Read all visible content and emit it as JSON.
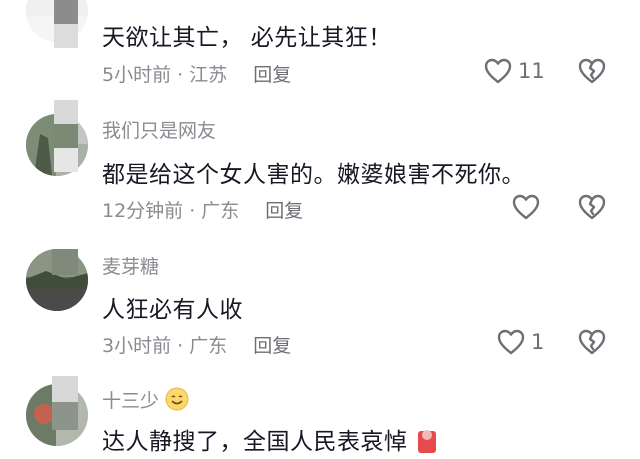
{
  "comments": [
    {
      "username": "",
      "text": "天欲让其亡， 必先让其狂！",
      "meta": "5小时前 · 江苏",
      "reply": "回复",
      "likes": "11",
      "icons": {
        "like": "heart-outline-icon",
        "dislike": "broken-heart-icon"
      }
    },
    {
      "username": "我们只是网友",
      "text": "都是给这个女人害的。嫩婆娘害不死你。",
      "meta": "12分钟前 · 广东",
      "reply": "回复",
      "likes": "",
      "icons": {
        "like": "heart-outline-icon",
        "dislike": "broken-heart-icon"
      }
    },
    {
      "username": "麦芽糖",
      "text": "人狂必有人收",
      "meta": "3小时前 · 广东",
      "reply": "回复",
      "likes": "1",
      "icons": {
        "like": "heart-outline-icon",
        "dislike": "broken-heart-icon"
      }
    },
    {
      "username": "十三少",
      "username_emoji": "smile-emoji-icon",
      "text": "达人静搜了，全国人民表哀悼",
      "text_emoji": "red-envelope-emoji-icon"
    }
  ],
  "colors": {
    "text": "#161823",
    "secondary": "#8a8b91",
    "icon": "#6e6f75",
    "background": "#ffffff"
  }
}
